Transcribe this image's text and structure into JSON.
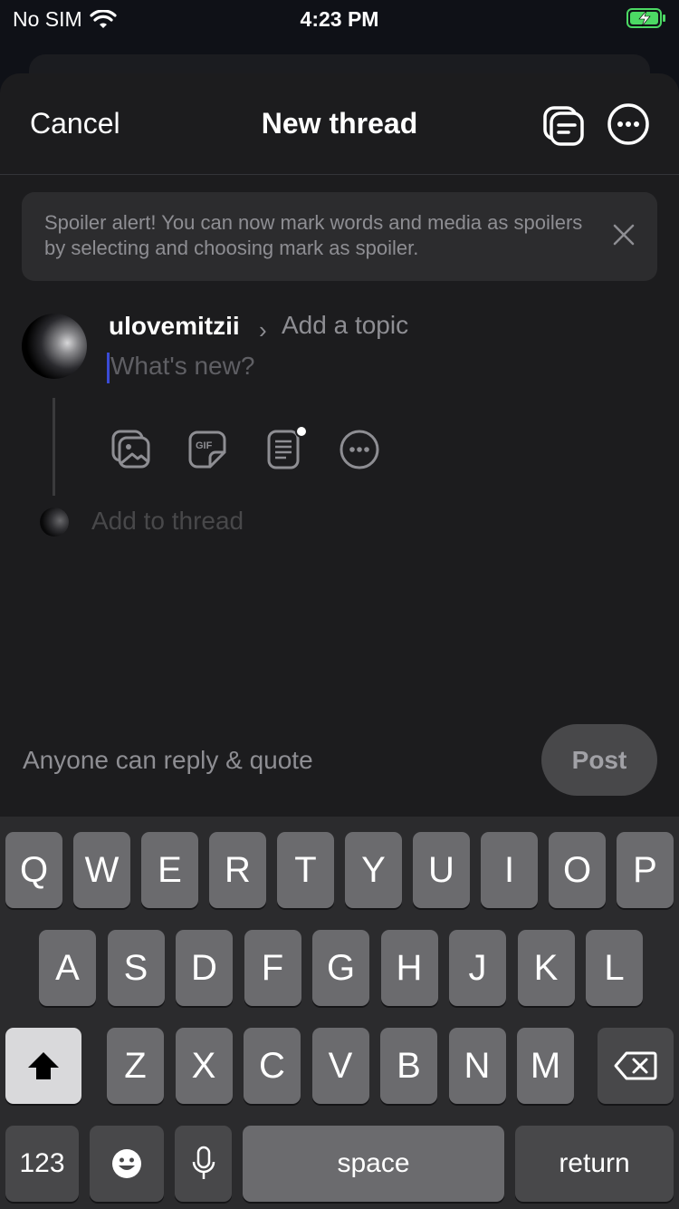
{
  "status_bar": {
    "carrier": "No SIM",
    "time": "4:23 PM",
    "battery_color": "#4cd964"
  },
  "nav": {
    "cancel_label": "Cancel",
    "title": "New thread",
    "icons": [
      "drafts-icon",
      "more-options-icon"
    ]
  },
  "banner": {
    "text": "Spoiler alert! You can now mark words and media as spoilers by selecting and choosing mark as spoiler."
  },
  "composer": {
    "username": "ulovemitzii",
    "topic_chevron": "›",
    "topic_placeholder": "Add a topic",
    "placeholder": "What's new?",
    "tools": [
      "gallery-icon",
      "gif-icon",
      "text-attachment-icon",
      "more-tools-icon"
    ],
    "add_to_thread": "Add to thread"
  },
  "footer": {
    "reply_setting": "Anyone can reply & quote",
    "post_label": "Post"
  },
  "keyboard": {
    "row1": [
      "Q",
      "W",
      "E",
      "R",
      "T",
      "Y",
      "U",
      "I",
      "O",
      "P"
    ],
    "row2": [
      "A",
      "S",
      "D",
      "F",
      "G",
      "H",
      "J",
      "K",
      "L"
    ],
    "row3": [
      "Z",
      "X",
      "C",
      "V",
      "B",
      "N",
      "M"
    ],
    "numbers_label": "123",
    "space_label": "space",
    "return_label": "return"
  },
  "colors": {
    "background": "#1c1c1e",
    "banner": "#2c2c2e",
    "accent_caret": "#3a4bd6"
  }
}
